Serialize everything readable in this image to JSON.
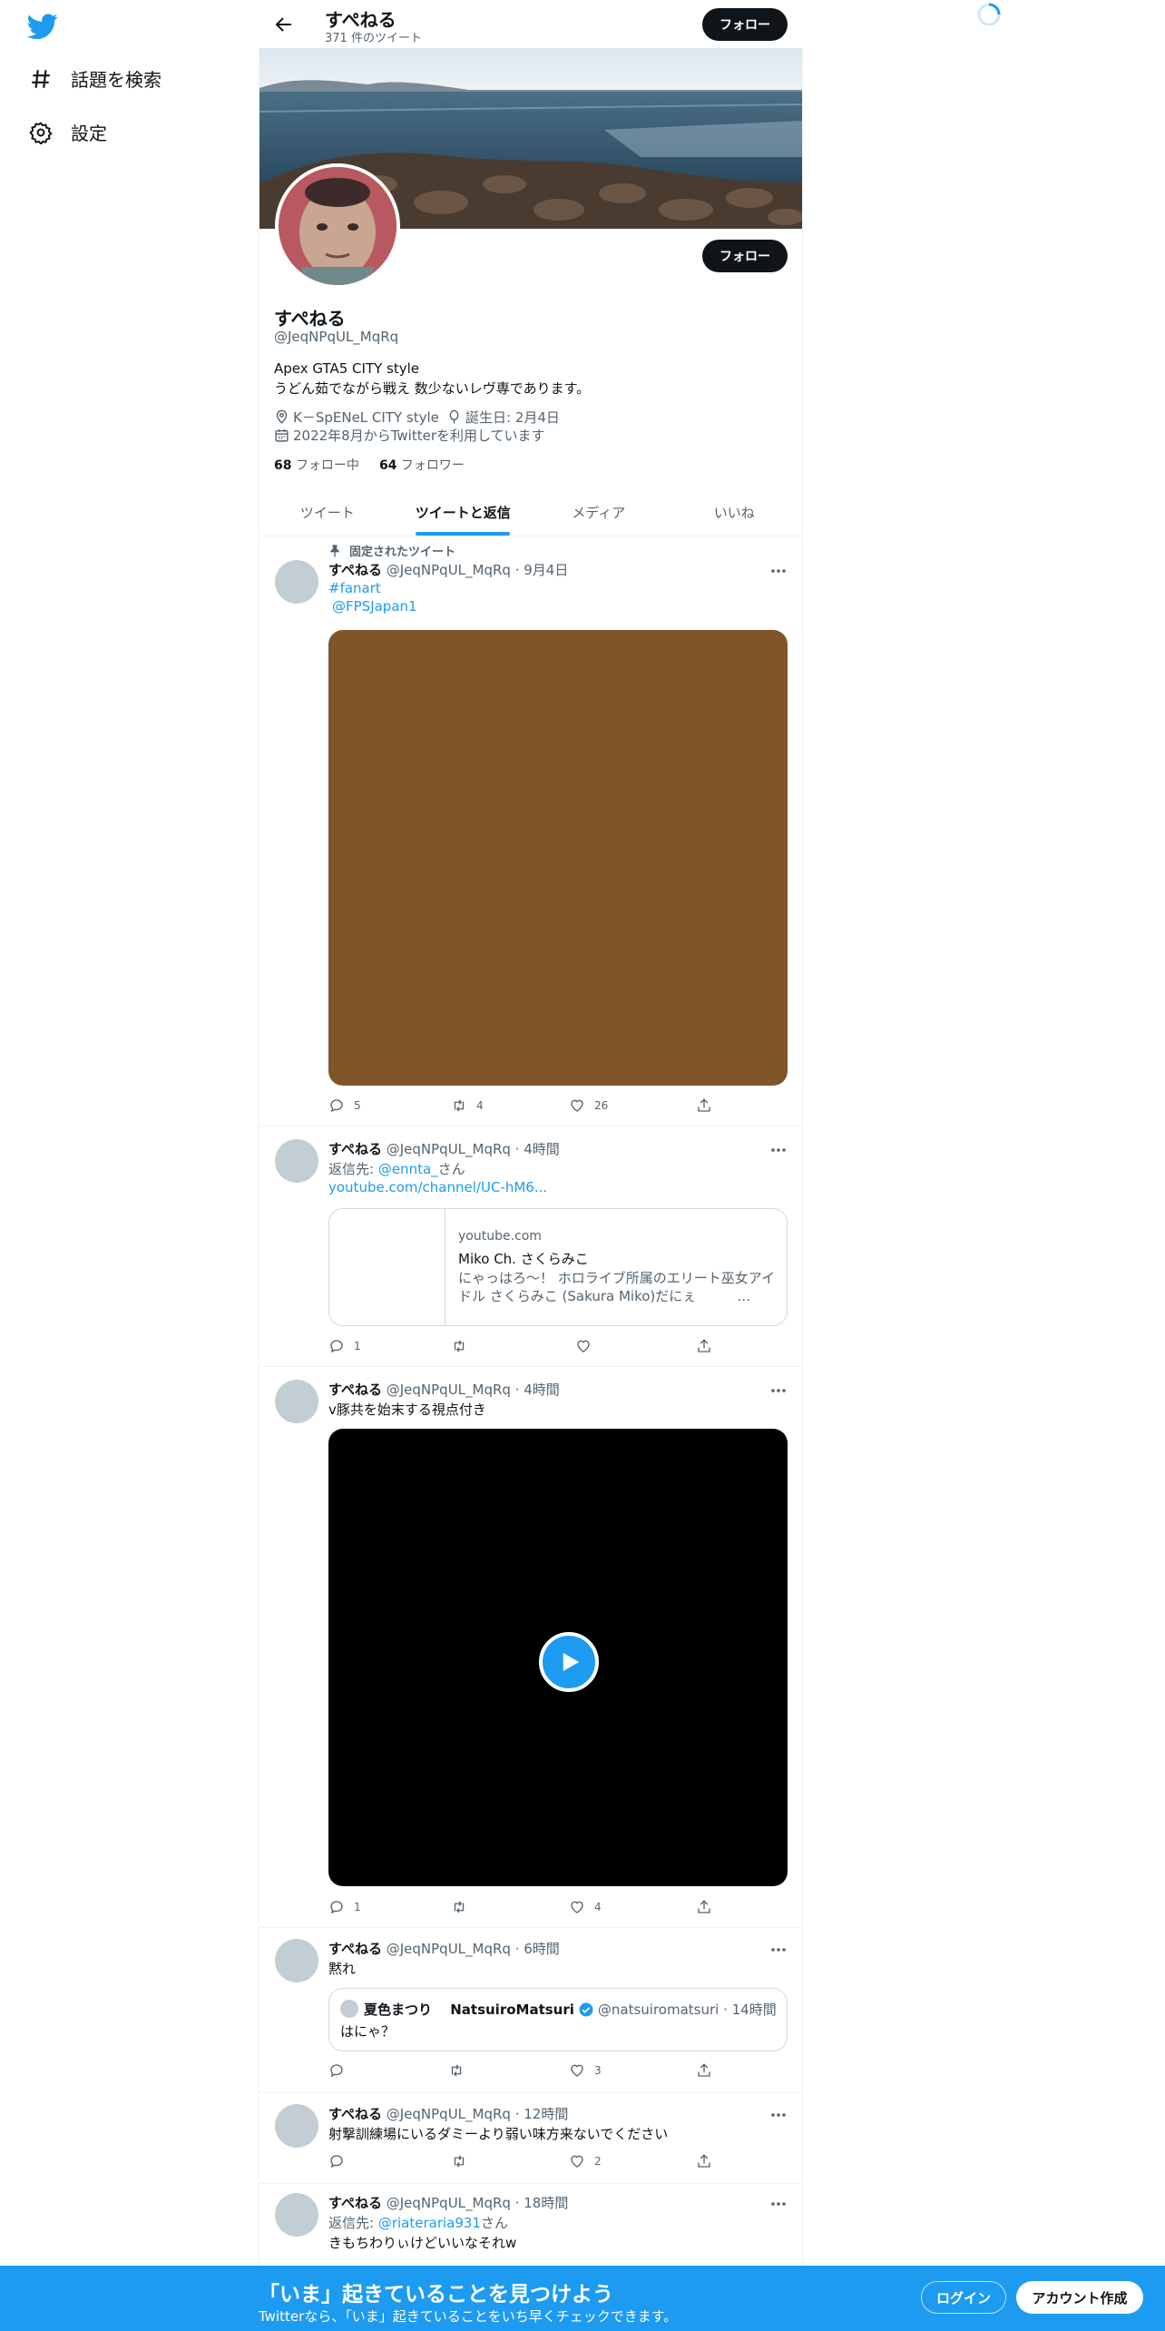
{
  "nav": {
    "explore_label": "話題を検索",
    "settings_label": "設定"
  },
  "header": {
    "name": "すぺねる",
    "tweet_count": "371 件のツイート",
    "follow_label": "フォロー"
  },
  "profile": {
    "name": "すぺねる",
    "handle": "@JeqNPqUL_MqRq",
    "bio_line1": "Apex GTA5 CITY style",
    "bio_line2": "うどん茹でながら戦え 数少ないレヴ専であります。",
    "location": "K－SpENeL CITY style",
    "birthday": "誕生日: 2月4日",
    "joined": "2022年8月からTwitterを利用しています",
    "following_count": "68",
    "following_label": "フォロー中",
    "followers_count": "64",
    "followers_label": "フォロワー",
    "follow_label": "フォロー"
  },
  "tabs": [
    "ツイート",
    "ツイートと返信",
    "メディア",
    "いいね"
  ],
  "pinned_label": "固定されたツイート",
  "tweets": [
    {
      "name": "すぺねる",
      "meta": "@JeqNPqUL_MqRq · 9月4日",
      "line1": "#fanart",
      "line2": "@FPSJapan1",
      "reply": "5",
      "retweet": "4",
      "like": "26"
    },
    {
      "name": "すぺねる",
      "meta": "@JeqNPqUL_MqRq · 4時間",
      "reply_prefix": "返信先: ",
      "reply_to": "@ennta_",
      "reply_suffix": "さん",
      "link": "youtube.com/channel/UC-hM6...",
      "card_domain": "youtube.com",
      "card_title": "Miko Ch. さくらみこ",
      "card_desc": "にゃっはろ～！ ホロライブ所属のエリート巫女アイドル さくらみこ (Sakura Miko)だにぇ　　　…",
      "reply": "1",
      "retweet": "",
      "like": ""
    },
    {
      "name": "すぺねる",
      "meta": "@JeqNPqUL_MqRq · 4時間",
      "text": "v豚共を始末する視点付き",
      "reply": "1",
      "retweet": "",
      "like": "4"
    },
    {
      "name": "すぺねる",
      "meta": "@JeqNPqUL_MqRq · 6時間",
      "text": "黙れ",
      "quote_name": "夏色まつり　 NatsuiroMatsuri",
      "quote_meta": "@natsuiromatsuri · 14時間",
      "quote_text": "はにゃ？",
      "reply": "",
      "retweet": "",
      "like": "3"
    },
    {
      "name": "すぺねる",
      "meta": "@JeqNPqUL_MqRq · 12時間",
      "text": "射撃訓練場にいるダミーより弱い味方来ないでください",
      "reply": "",
      "retweet": "",
      "like": "2"
    },
    {
      "name": "すぺねる",
      "meta": "@JeqNPqUL_MqRq · 18時間",
      "reply_prefix": "返信先: ",
      "reply_to": "@riateraria931",
      "reply_suffix": "さん",
      "text": "きもちわりぃけどいいなそれw"
    }
  ],
  "bottom_bar": {
    "title": "「いま」起きていることを見つけよう",
    "subtitle": "Twitterなら、「いま」起きていることをいち早くチェックできます。",
    "login_label": "ログイン",
    "signup_label": "アカウント作成"
  },
  "colors": {
    "accent": "#1d9bf0",
    "media_brown": "#7f5529",
    "bottom_bar": "#1d9bf0"
  }
}
